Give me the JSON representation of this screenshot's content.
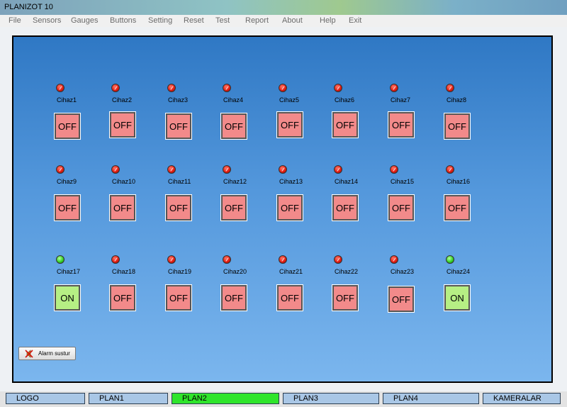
{
  "window": {
    "title": "PLANIZOT 10"
  },
  "menu": [
    "File",
    "Sensors",
    "Gauges",
    "Buttons",
    "Setting",
    "Reset",
    "Test",
    "Report",
    "About",
    "Help",
    "Exit"
  ],
  "devices": [
    {
      "label": "Cihaz1",
      "state": "OFF"
    },
    {
      "label": "Cihaz2",
      "state": "OFF"
    },
    {
      "label": "Cihaz3",
      "state": "OFF"
    },
    {
      "label": "Cihaz4",
      "state": "OFF"
    },
    {
      "label": "Cihaz5",
      "state": "OFF"
    },
    {
      "label": "Cihaz6",
      "state": "OFF"
    },
    {
      "label": "Cihaz7",
      "state": "OFF"
    },
    {
      "label": "Cihaz8",
      "state": "OFF"
    },
    {
      "label": "Cihaz9",
      "state": "OFF"
    },
    {
      "label": "Cihaz10",
      "state": "OFF"
    },
    {
      "label": "Cihaz11",
      "state": "OFF"
    },
    {
      "label": "Cihaz12",
      "state": "OFF"
    },
    {
      "label": "Cihaz13",
      "state": "OFF"
    },
    {
      "label": "Cihaz14",
      "state": "OFF"
    },
    {
      "label": "Cihaz15",
      "state": "OFF"
    },
    {
      "label": "Cihaz16",
      "state": "OFF"
    },
    {
      "label": "Cihaz17",
      "state": "ON"
    },
    {
      "label": "Cihaz18",
      "state": "OFF"
    },
    {
      "label": "Cihaz19",
      "state": "OFF"
    },
    {
      "label": "Cihaz20",
      "state": "OFF"
    },
    {
      "label": "Cihaz21",
      "state": "OFF"
    },
    {
      "label": "Cihaz22",
      "state": "OFF"
    },
    {
      "label": "Cihaz23",
      "state": "OFF"
    },
    {
      "label": "Cihaz24",
      "state": "ON"
    }
  ],
  "alarm_button": {
    "label": "Alarm sustur",
    "icon": "alarm-mute-icon"
  },
  "tabs": [
    {
      "label": "LOGO",
      "active": false
    },
    {
      "label": "PLAN1",
      "active": false
    },
    {
      "label": "PLAN2",
      "active": true
    },
    {
      "label": "PLAN3",
      "active": false
    },
    {
      "label": "PLAN4",
      "active": false
    },
    {
      "label": "KAMERALAR",
      "active": false
    }
  ],
  "colors": {
    "led_on": "#36d22a",
    "led_off": "#e21d12",
    "button_on": "#b6ef84",
    "button_off": "#f28a8a",
    "tab_active": "#2fe52b",
    "tab_inactive": "#a9c7e6"
  }
}
